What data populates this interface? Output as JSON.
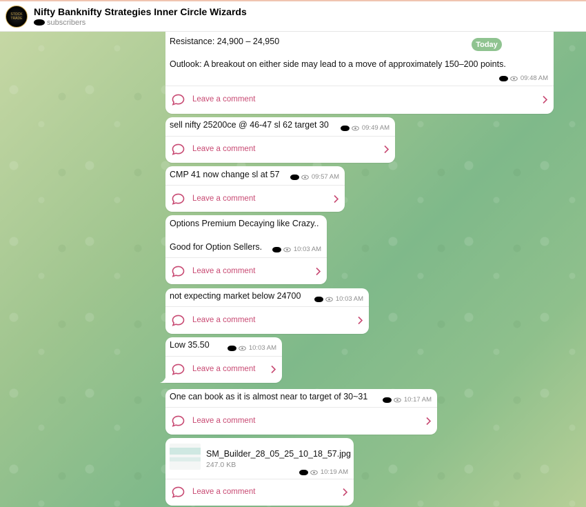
{
  "header": {
    "title": "Nifty Banknifty Strategies Inner Circle Wizards",
    "subscribers_label": "subscribers",
    "avatar_text": "STOCK TRADE"
  },
  "date_badge": "Today",
  "comment_label": "Leave a comment",
  "messages": [
    {
      "lines": [
        "Resistance: 24,900 – 24,950",
        "Outlook: A breakout on either side may lead to a move of approximately 150–200 points."
      ],
      "time": "09:48 AM"
    },
    {
      "lines": [
        "sell nifty 25200ce @ 46-47 sl 62 target 30"
      ],
      "time": "09:49 AM"
    },
    {
      "lines": [
        "CMP 41 now change sl at 57"
      ],
      "time": "09:57 AM"
    },
    {
      "lines": [
        "Options Premium Decaying like Crazy..",
        "Good for Option Sellers."
      ],
      "time": "10:03 AM"
    },
    {
      "lines": [
        "not expecting market below 24700"
      ],
      "time": "10:03 AM"
    },
    {
      "lines": [
        "Low 35.50"
      ],
      "time": "10:03 AM"
    },
    {
      "lines": [
        "One can book as it is almost near to target of 30~31"
      ],
      "time": "10:17 AM"
    },
    {
      "file": {
        "name": "SM_Builder_28_05_25_10_18_57.jpg",
        "size": "247.0 KB"
      },
      "time": "10:19 AM"
    }
  ],
  "colors": {
    "accent_comment": "#c84a73",
    "badge_bg": "#8fc390",
    "bubble": "#ffffff"
  },
  "icons": [
    "comment-bubble-icon",
    "chevron-right-icon",
    "eye-icon"
  ]
}
